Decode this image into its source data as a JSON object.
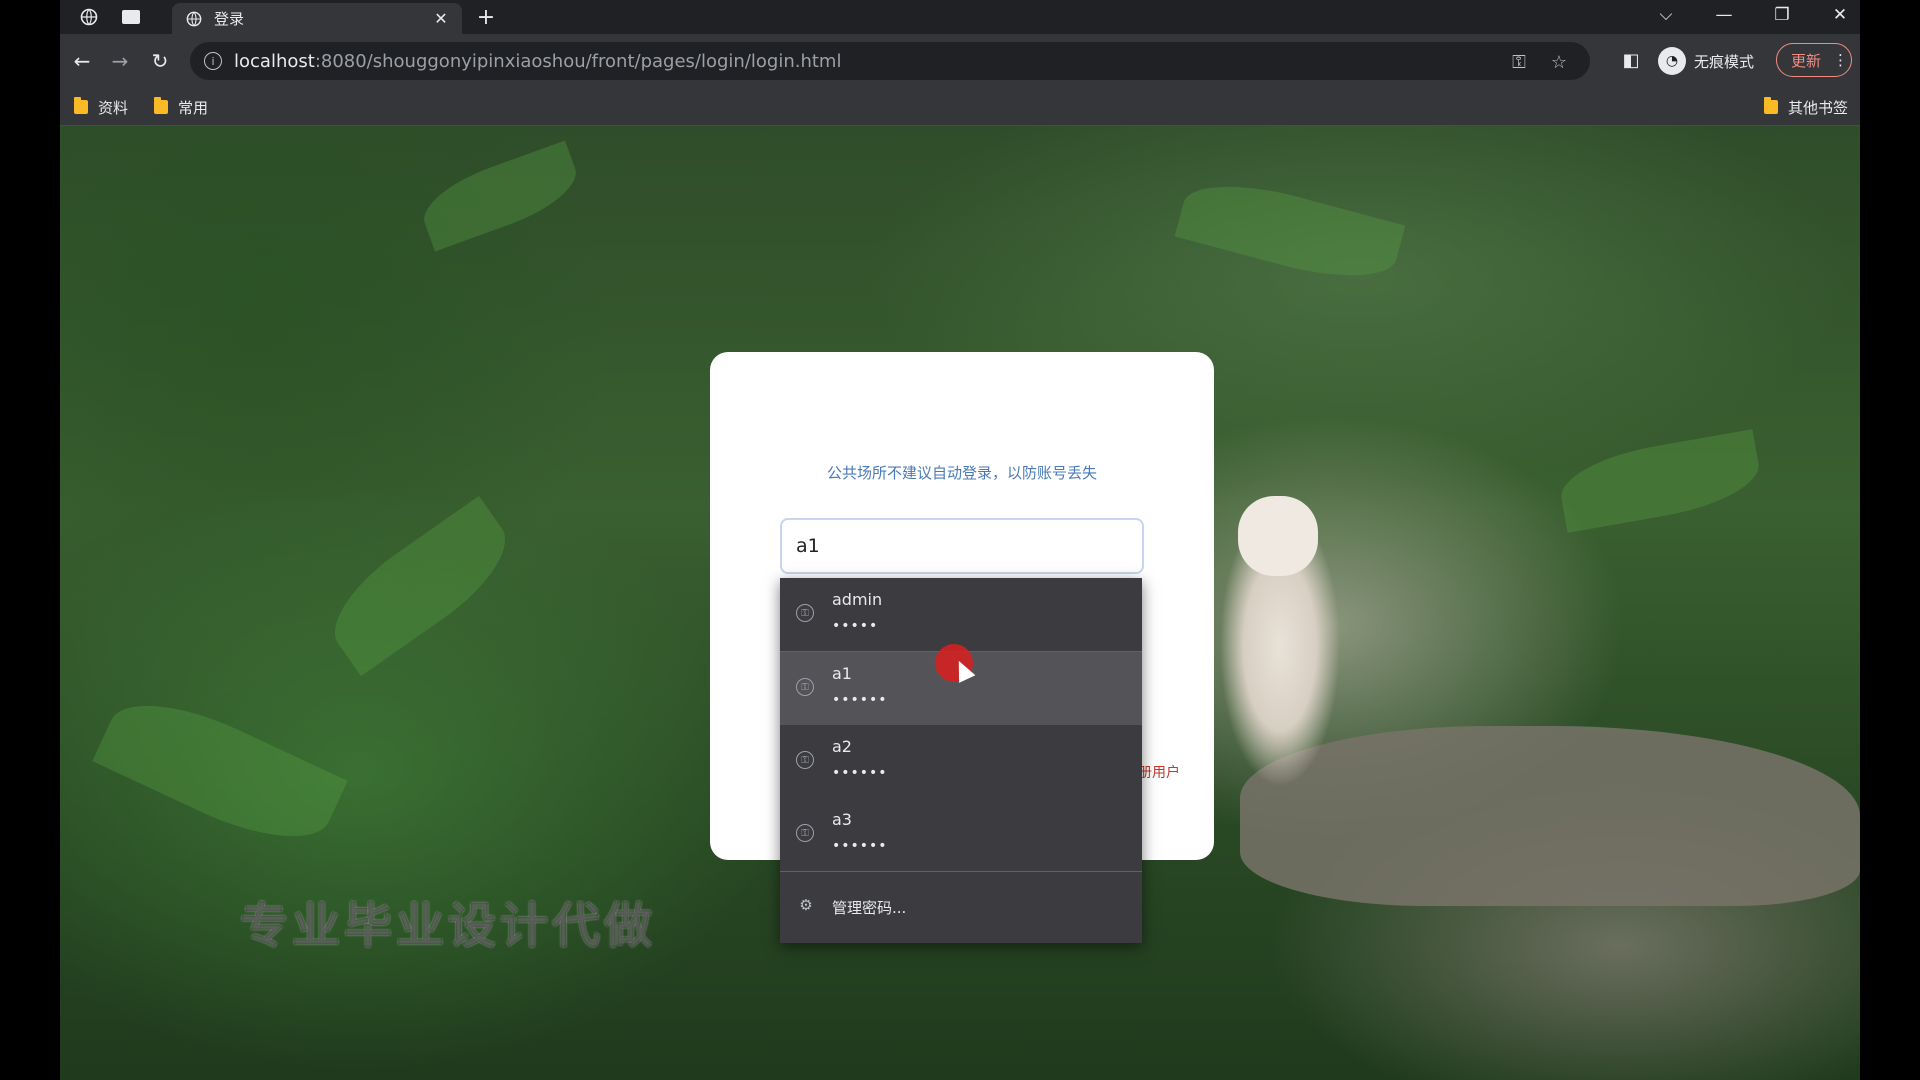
{
  "browser": {
    "tab": {
      "title": "登录"
    },
    "address": {
      "host": "localhost",
      "rest": ":8080/shouggonyipinxiaoshou/front/pages/login/login.html"
    },
    "incognito_label": "无痕模式",
    "update_label": "更新",
    "bookmarks": [
      {
        "label": "资料"
      },
      {
        "label": "常用"
      }
    ],
    "other_bookmarks": "其他书签",
    "icons": [
      "globe-icon",
      "window-icon",
      "close-icon",
      "plus-icon",
      "chevron-down-icon",
      "minimize-icon",
      "restore-icon",
      "back-arrow-icon",
      "forward-arrow-icon",
      "reload-icon",
      "info-icon",
      "key-icon",
      "star-icon",
      "sidepanel-icon",
      "more-icon",
      "folder-icon"
    ]
  },
  "login": {
    "notice": "公共场所不建议自动登录，以防账号丢失",
    "username_value": "a1",
    "register_link": "注册用户"
  },
  "autofill": {
    "items": [
      {
        "user": "admin",
        "pass": "•••••"
      },
      {
        "user": "a1",
        "pass": "••••••"
      },
      {
        "user": "a2",
        "pass": "••••••"
      },
      {
        "user": "a3",
        "pass": "••••••"
      }
    ],
    "manage_label": "管理密码..."
  },
  "watermark": "专业毕业设计代做"
}
